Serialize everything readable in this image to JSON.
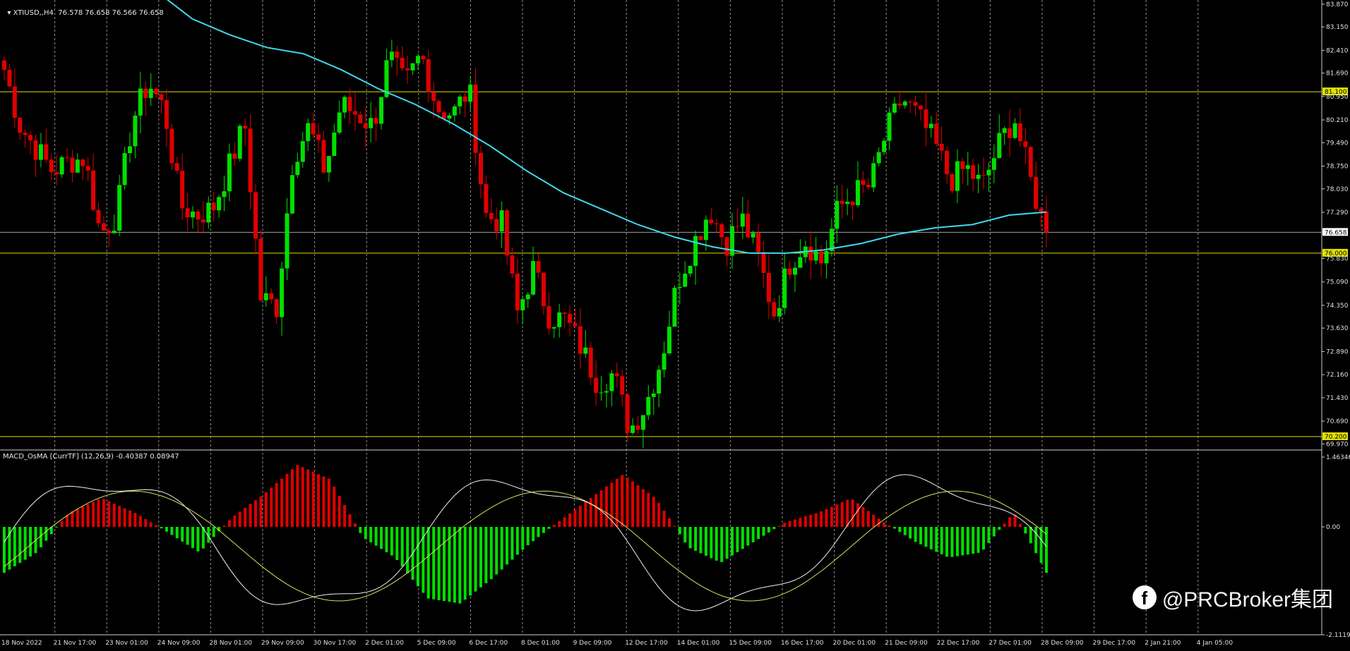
{
  "header": {
    "symbol_label": "XTIUSD,,H4",
    "ohlc": "76.578 76.658 76.566 76.658",
    "indicator_label": "MACD_OsMA [CurrTF] (12,26,9) -0.40387 0.08947"
  },
  "price_axis": {
    "ticks": [
      "83.870",
      "83.150",
      "82.410",
      "81.690",
      "80.950",
      "80.210",
      "79.490",
      "78.750",
      "78.030",
      "77.290",
      "75.830",
      "75.090",
      "74.350",
      "73.630",
      "72.890",
      "72.160",
      "71.430",
      "70.690",
      "69.970"
    ],
    "current_price": "76.658",
    "levels": [
      "81.100",
      "76.000",
      "70.200"
    ]
  },
  "indicator_axis": {
    "ticks": [
      "1.46346",
      "0.00",
      "-2.11198"
    ]
  },
  "time_axis": {
    "labels": [
      "18 Nov 2022",
      "21 Nov 17:00",
      "23 Nov 01:00",
      "24 Nov 09:00",
      "28 Nov 01:00",
      "29 Nov 09:00",
      "30 Nov 17:00",
      "2 Dec 01:00",
      "5 Dec 09:00",
      "6 Dec 17:00",
      "8 Dec 01:00",
      "9 Dec 09:00",
      "12 Dec 17:00",
      "14 Dec 01:00",
      "15 Dec 09:00",
      "16 Dec 17:00",
      "20 Dec 01:00",
      "21 Dec 09:00",
      "22 Dec 17:00",
      "27 Dec 01:00",
      "28 Dec 09:00",
      "29 Dec 17:00",
      "2 Jan 21:00",
      "4 Jan 05:00"
    ]
  },
  "watermark": {
    "icon": "facebook-icon",
    "text": "@PRCBroker集团"
  },
  "colors": {
    "bull": "#00e000",
    "bear": "#e00000",
    "ma": "#40d8f0",
    "level": "#e0e000",
    "grid": "#909090",
    "macd_line": "#f0f0f0",
    "signal_line": "#e0e060"
  },
  "chart_data": {
    "type": "candlestick",
    "ohlc_close_anchors": [
      81.8,
      80.0,
      79.3,
      78.6,
      78.9,
      79.0,
      76.6,
      77.2,
      80.2,
      81.4,
      80.5,
      77.5,
      77.2,
      77.4,
      78.7,
      80.1,
      74.6,
      74.3,
      79.0,
      80.0,
      78.6,
      80.7,
      80.4,
      80.0,
      82.2,
      81.3,
      82.3,
      80.6,
      80.4,
      81.2,
      77.2,
      77.0,
      74.1,
      75.5,
      74.0,
      73.9,
      73.0,
      71.9,
      72.2,
      70.4,
      71.2,
      72.7,
      75.1,
      76.3,
      77.4,
      76.3,
      77.1,
      75.9,
      74.1,
      75.7,
      76.4,
      75.7,
      77.4,
      77.9,
      78.1,
      79.8,
      80.9,
      80.3,
      79.5,
      78.3,
      78.7,
      78.1,
      79.4,
      80.3,
      78.3,
      76.6
    ],
    "ma_y": [
      84.3,
      83.4,
      82.9,
      82.5,
      82.3,
      81.8,
      81.2,
      80.7,
      80.1,
      79.4,
      78.6,
      77.9,
      77.4,
      76.9,
      76.5,
      76.2,
      76.0,
      76.0,
      76.1,
      76.3,
      76.6,
      76.8,
      76.9,
      77.2,
      77.3
    ],
    "macd_hist": [
      -0.9,
      -0.5,
      0.3,
      0.6,
      0.3,
      -0.1,
      -0.5,
      0.2,
      0.7,
      1.3,
      1.0,
      -0.2,
      -0.6,
      -1.4,
      -1.5,
      -1.0,
      -0.4,
      0.1,
      0.6,
      1.1,
      0.6,
      -0.4,
      -0.7,
      -0.3,
      0.1,
      0.3,
      0.6,
      0.1,
      -0.3,
      -0.6,
      -0.5,
      0.3,
      -0.9
    ],
    "level_labels": [
      "81.100",
      "76.000",
      "70.200"
    ]
  }
}
